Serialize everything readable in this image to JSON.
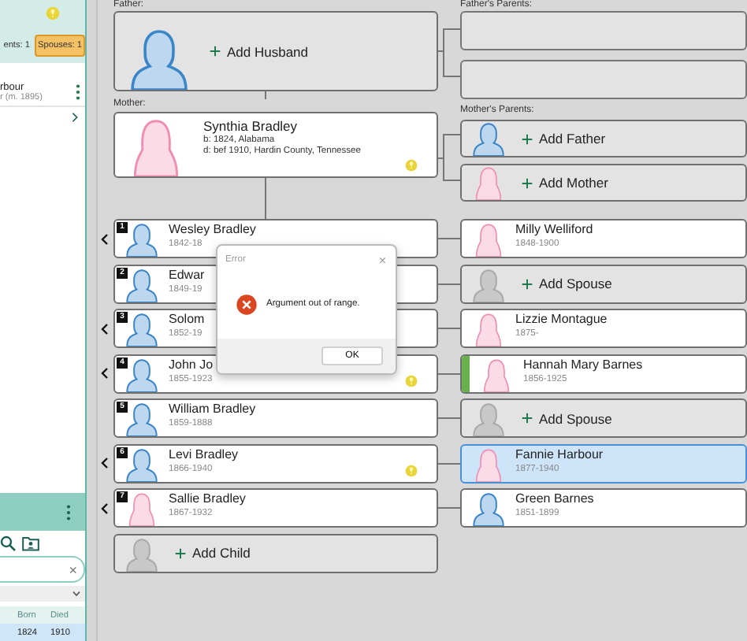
{
  "left_panel": {
    "hint": true,
    "tabs": [
      {
        "label": "ents: 1",
        "selected": false
      },
      {
        "label": "Spouses: 1",
        "selected": true
      }
    ],
    "spouse_item": {
      "name": "rbour",
      "detail": "r (m. 1895)"
    },
    "search": {
      "clear": "×"
    },
    "table": {
      "columns": [
        "Born",
        "Died"
      ],
      "rows": [
        {
          "cells": [
            "1824",
            "1910"
          ],
          "selected": true
        }
      ]
    }
  },
  "father": {
    "label": "Father:",
    "add": "Add Husband",
    "female": false
  },
  "fathers_parents": {
    "label": "Father's Parents:",
    "slots": [
      {
        "kind": "empty"
      },
      {
        "kind": "empty"
      }
    ]
  },
  "mother": {
    "label": "Mother:",
    "name": "Synthia Bradley",
    "lines": [
      "b: 1824, Alabama",
      "d: bef 1910, Hardin County, Tennessee"
    ],
    "female": true,
    "hint": true
  },
  "mothers_parents": {
    "label": "Mother's Parents:",
    "slots": [
      {
        "kind": "add",
        "label": "Add Father",
        "female": false
      },
      {
        "kind": "add",
        "label": "Add Mother",
        "female": true
      }
    ]
  },
  "children": [
    {
      "number": "1",
      "name": "Wesley Bradley",
      "dates": "1842-18",
      "female": false,
      "expandable": true,
      "hint": false,
      "spouse": {
        "kind": "person",
        "name": "Milly Welliford",
        "dates": "1848-1900",
        "female": true,
        "selected": false,
        "tagged": false
      }
    },
    {
      "number": "2",
      "name": "Edwar",
      "dates": "1849-19",
      "female": false,
      "expandable": false,
      "hint": false,
      "spouse": {
        "kind": "add",
        "label": "Add Spouse"
      }
    },
    {
      "number": "3",
      "name": "Solom",
      "dates": "1852-19",
      "female": false,
      "expandable": true,
      "hint": false,
      "spouse": {
        "kind": "person",
        "name": "Lizzie Montague",
        "dates": "1875-",
        "female": true,
        "selected": false,
        "tagged": false
      }
    },
    {
      "number": "4",
      "name": "John Jo",
      "dates": "1855-1923",
      "female": false,
      "expandable": true,
      "hint": true,
      "spouse": {
        "kind": "person",
        "name": "Hannah Mary Barnes",
        "dates": "1856-1925",
        "female": true,
        "selected": false,
        "tagged": true
      }
    },
    {
      "number": "5",
      "name": "William Bradley",
      "dates": "1859-1888",
      "female": false,
      "expandable": false,
      "hint": false,
      "spouse": {
        "kind": "add",
        "label": "Add Spouse"
      }
    },
    {
      "number": "6",
      "name": "Levi Bradley",
      "dates": "1866-1940",
      "female": false,
      "expandable": true,
      "hint": true,
      "spouse": {
        "kind": "person",
        "name": "Fannie Harbour",
        "dates": "1877-1940",
        "female": true,
        "selected": true,
        "tagged": false
      }
    },
    {
      "number": "7",
      "name": "Sallie Bradley",
      "dates": "1867-1932",
      "female": true,
      "expandable": true,
      "hint": false,
      "spouse": {
        "kind": "person",
        "name": "Green Barnes",
        "dates": "1851-1899",
        "female": false,
        "selected": false,
        "tagged": false
      }
    }
  ],
  "add_child": {
    "label": "Add Child"
  },
  "dialog": {
    "title": "Error",
    "close": "×",
    "message": "Argument out of range.",
    "buttons": [
      "OK"
    ]
  }
}
